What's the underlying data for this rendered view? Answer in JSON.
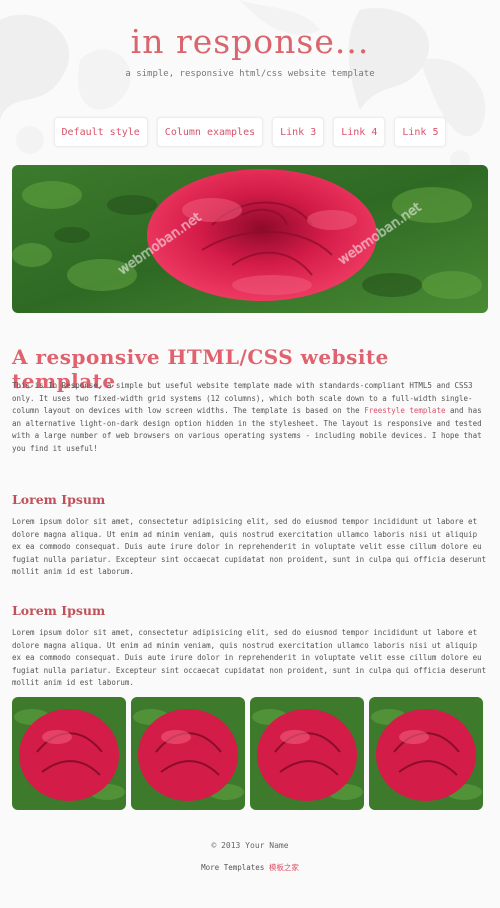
{
  "header": {
    "title": "in response...",
    "subtitle": "a simple, responsive html/css website template"
  },
  "nav": {
    "items": [
      {
        "label": "Default style"
      },
      {
        "label": "Column examples"
      },
      {
        "label": "Link 3"
      },
      {
        "label": "Link 4"
      },
      {
        "label": "Link 5"
      }
    ]
  },
  "main": {
    "heading": "A responsive HTML/CSS website template",
    "intro_before": "This is In Response, a simple but useful website template made with standards-compliant HTML5 and CSS3 only. It uses two fixed-width grid systems (12 columns), which both scale down to a full-width single-column layout on devices with low screen widths. The template is based on the ",
    "intro_link": "Freestyle template",
    "intro_after": " and has an alternative light-on-dark design option hidden in the stylesheet. The layout is responsive and tested with a large number of web browsers on various operating systems - including mobile devices. I hope that you find it useful!",
    "sections": [
      {
        "title": "Lorem Ipsum",
        "body": "Lorem ipsum dolor sit amet, consectetur adipisicing elit, sed do eiusmod tempor incididunt ut labore et dolore magna aliqua. Ut enim ad minim veniam, quis nostrud exercitation ullamco laboris nisi ut aliquip ex ea commodo consequat. Duis aute irure dolor in reprehenderit in voluptate velit esse cillum dolore eu fugiat nulla pariatur. Excepteur sint occaecat cupidatat non proident, sunt in culpa qui officia deserunt mollit anim id est laborum."
      },
      {
        "title": "Lorem Ipsum",
        "body": "Lorem ipsum dolor sit amet, consectetur adipisicing elit, sed do eiusmod tempor incididunt ut labore et dolore magna aliqua. Ut enim ad minim veniam, quis nostrud exercitation ullamco laboris nisi ut aliquip ex ea commodo consequat. Duis aute irure dolor in reprehenderit in voluptate velit esse cillum dolore eu fugiat nulla pariatur. Excepteur sint occaecat cupidatat non proident, sunt in culpa qui officia deserunt mollit anim id est laborum."
      }
    ]
  },
  "footer": {
    "copyright": "© 2013 Your Name",
    "more_label": "More Templates",
    "more_link": "模板之家"
  },
  "images": {
    "watermark": "webmoban.net"
  },
  "colors": {
    "accent": "#d9656d",
    "link": "#d9536a"
  }
}
